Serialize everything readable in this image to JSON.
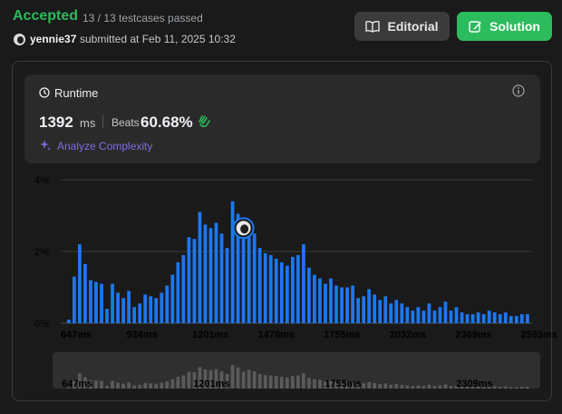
{
  "header": {
    "status": "Accepted",
    "testcases": "13 / 13 testcases passed",
    "username": "yennie37",
    "submitted_text": "submitted at Feb 11, 2025 10:32",
    "editorial_label": "Editorial",
    "solution_label": "Solution"
  },
  "runtime": {
    "title": "Runtime",
    "value": "1392",
    "unit": "ms",
    "beats_label": "Beats",
    "beats_value": "60.68%",
    "analyze_label": "Analyze Complexity"
  },
  "colors": {
    "accent_green": "#2cbb5d",
    "bar_blue": "#1d77f2",
    "analyze_purple": "#7c6ee6"
  },
  "chart_data": {
    "type": "bar",
    "title": "",
    "xlabel": "",
    "ylabel": "",
    "ylim": [
      0,
      4
    ],
    "yticks": [
      "0%",
      "2%",
      "4%"
    ],
    "xtick_labels": [
      "647ms",
      "924ms",
      "1201ms",
      "1478ms",
      "1755ms",
      "2032ms",
      "2309ms",
      "2585ms"
    ],
    "xrange_ms": [
      647,
      2862
    ],
    "bin_width_ms": 23,
    "current_runtime_ms": 1392,
    "values": [
      0.1,
      1.3,
      2.2,
      1.65,
      1.2,
      1.15,
      1.1,
      0.4,
      1.1,
      0.85,
      0.7,
      0.9,
      0.45,
      0.55,
      0.8,
      0.75,
      0.7,
      0.85,
      1.05,
      1.35,
      1.7,
      1.9,
      2.4,
      2.35,
      3.1,
      2.75,
      2.65,
      2.8,
      2.5,
      2.1,
      3.4,
      3.05,
      2.45,
      2.7,
      2.5,
      2.1,
      1.95,
      1.9,
      1.8,
      1.7,
      1.6,
      1.85,
      1.9,
      2.2,
      1.55,
      1.35,
      1.25,
      1.1,
      1.25,
      1.05,
      1.0,
      1.0,
      1.05,
      0.7,
      0.75,
      0.95,
      0.8,
      0.65,
      0.75,
      0.55,
      0.65,
      0.55,
      0.45,
      0.35,
      0.45,
      0.35,
      0.55,
      0.35,
      0.45,
      0.6,
      0.35,
      0.45,
      0.3,
      0.25,
      0.25,
      0.3,
      0.25,
      0.35,
      0.3,
      0.25,
      0.3,
      0.2,
      0.2,
      0.25,
      0.25
    ]
  },
  "mini_chart": {
    "xtick_labels": [
      "647ms",
      "1201ms",
      "1755ms",
      "2309ms"
    ]
  }
}
